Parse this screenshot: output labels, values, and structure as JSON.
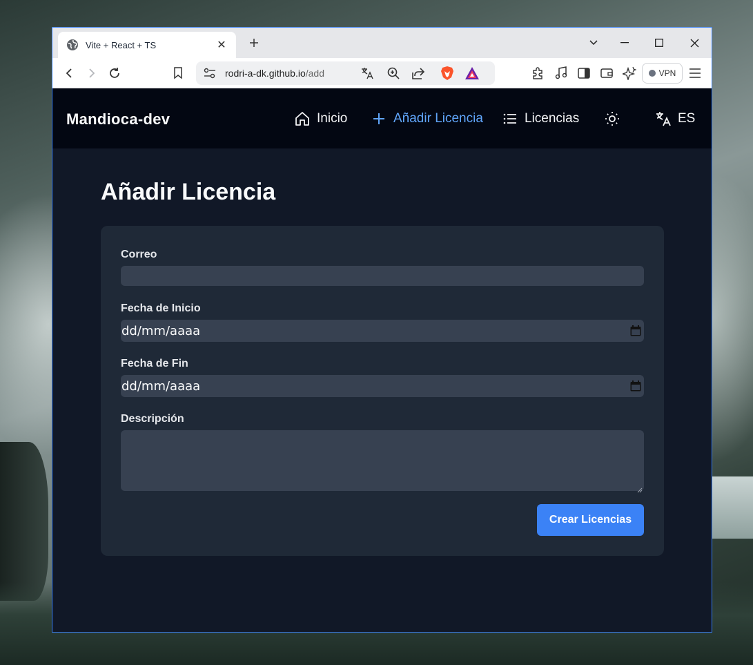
{
  "browser": {
    "tab_title": "Vite + React + TS",
    "url_host": "rodri-a-dk.github.io",
    "url_path": "/add",
    "vpn_label": "VPN"
  },
  "nav": {
    "brand": "Mandioca-dev",
    "items": [
      {
        "label": "Inicio",
        "icon": "home-icon"
      },
      {
        "label": "Añadir Licencia",
        "icon": "plus-icon",
        "active": true
      },
      {
        "label": "Licencias",
        "icon": "list-icon"
      }
    ],
    "theme_icon": "sun-icon",
    "language_label": "ES"
  },
  "page": {
    "title": "Añadir Licencia"
  },
  "form": {
    "email_label": "Correo",
    "email_value": "",
    "start_date_label": "Fecha de Inicio",
    "start_date_value": "dd/mm/aaaa",
    "end_date_label": "Fecha de Fin",
    "end_date_value": "dd/mm/aaaa",
    "description_label": "Descripción",
    "description_value": "",
    "submit_label": "Crear Licencias"
  },
  "colors": {
    "accent": "#3b82f6",
    "active_link": "#60a5fa",
    "nav_bg": "#030712",
    "page_bg": "#111827",
    "card_bg": "#1f2937",
    "input_bg": "#374151"
  }
}
